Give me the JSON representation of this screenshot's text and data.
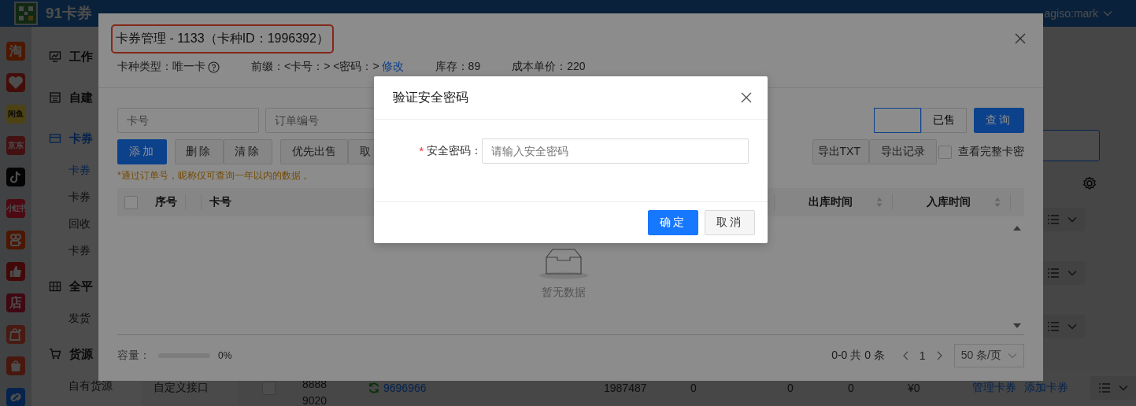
{
  "header": {
    "title": "91卡券",
    "user": "agiso:mark"
  },
  "app_rail": [
    {
      "kind": "text",
      "label": "淘"
    },
    {
      "kind": "heart"
    },
    {
      "kind": "text",
      "label": "闲鱼"
    },
    {
      "kind": "text",
      "label": "京东"
    },
    {
      "kind": "tiktok"
    },
    {
      "kind": "text",
      "label": "小红书"
    },
    {
      "kind": "kuaishou"
    },
    {
      "kind": "thumb"
    },
    {
      "kind": "text",
      "label": "店"
    },
    {
      "kind": "bag"
    },
    {
      "kind": "shopee"
    },
    {
      "kind": "link"
    }
  ],
  "sidebar": [
    {
      "label": "工作",
      "selected": false
    },
    {
      "label": "自建",
      "selected": false
    },
    {
      "label": "卡券",
      "selected": true,
      "children": [
        {
          "label": "卡券",
          "selected": true
        },
        {
          "label": "卡券",
          "selected": false
        },
        {
          "label": "回收",
          "selected": false
        },
        {
          "label": "卡券",
          "selected": false
        }
      ]
    },
    {
      "label": "全平",
      "selected": false,
      "children": [
        {
          "label": "发货",
          "selected": false
        }
      ]
    },
    {
      "label": "货源",
      "selected": false,
      "children": [
        {
          "label": "自有货源",
          "selected": false
        }
      ]
    }
  ],
  "main": {
    "side_label": "自定义接口",
    "row": {
      "checked": false,
      "card_lines": [
        "8888",
        "9020"
      ],
      "link": "9696966",
      "cells": [
        "1987487",
        "0",
        "0",
        "0",
        "¥0"
      ],
      "actions": [
        "管理卡券",
        "添加卡券"
      ]
    }
  },
  "card_modal": {
    "title": "卡券管理 - 1133（卡种ID：1996392）",
    "title_highlighted": true,
    "info": [
      {
        "kind": "help",
        "text": "卡种类型：唯一卡"
      },
      {
        "kind": "link",
        "text": "前缀：<卡号：> <密码：>",
        "link": "修改"
      },
      {
        "kind": "plain",
        "text": "库存：89"
      },
      {
        "kind": "plain",
        "text": "成本单价：220"
      }
    ],
    "inputs": [
      {
        "placeholder": "卡号"
      },
      {
        "placeholder": "订单编号"
      }
    ],
    "segments": [
      {
        "selected": true
      },
      {
        "label": "已售",
        "selected": false
      }
    ],
    "search_button": "查询",
    "actions_left": [
      {
        "label": "添加",
        "kind": "primary"
      },
      {
        "label": "删除",
        "kind": "group"
      },
      {
        "label": "清除",
        "kind": "group"
      },
      {
        "label": "优先出售",
        "kind": "default"
      },
      {
        "label": "取",
        "kind": "wide"
      }
    ],
    "actions_right": [
      {
        "label": "导出TXT",
        "kind": "wide"
      },
      {
        "label": "导出记录",
        "kind": "default"
      }
    ],
    "full_view": {
      "label": "查看完整卡密",
      "checked": false
    },
    "note": "*通过订单号，昵称仅可查询一年以内的数据 。",
    "table": {
      "all_checked": false,
      "columns": [
        {
          "label": "序号",
          "sortable": false
        },
        {
          "label": "卡号",
          "sortable": false
        },
        {
          "label": "出库时间",
          "sortable": true
        },
        {
          "label": "入库时间",
          "sortable": true
        }
      ],
      "empty_text": "暂无数据"
    },
    "footer": {
      "capacity_label": "容量：",
      "capacity": {
        "level": 0,
        "reading": "0%"
      },
      "range": "0-0 共 0 条",
      "page": "1",
      "page_size": "50 条/页"
    }
  },
  "verify_modal": {
    "title": "验证安全密码",
    "field": {
      "required_mark": "*",
      "label": "安全密码：",
      "placeholder": "请输入安全密码"
    },
    "buttons": [
      {
        "label": "确定",
        "kind": "primary"
      },
      {
        "label": "取消",
        "kind": "default"
      }
    ]
  }
}
